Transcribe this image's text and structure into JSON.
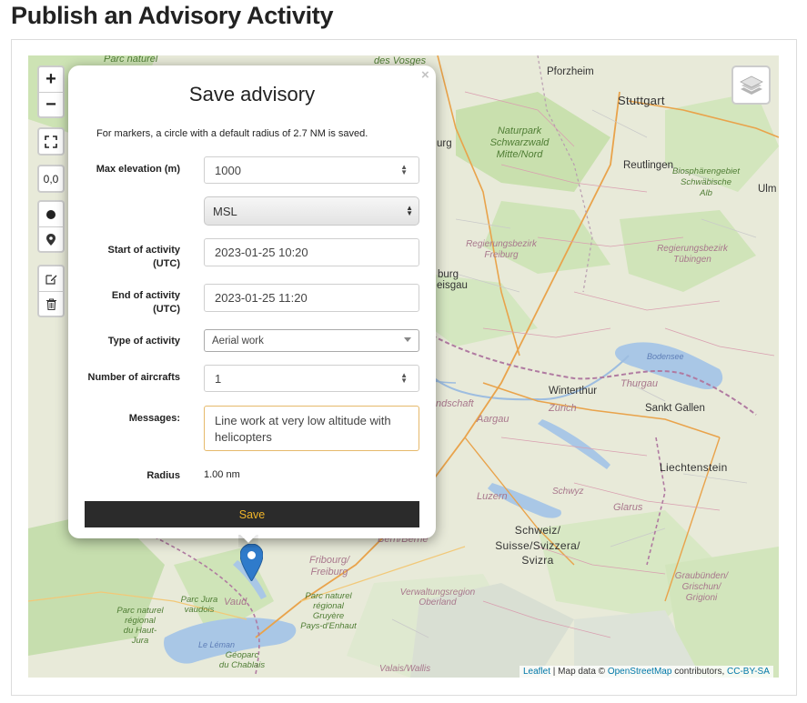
{
  "page": {
    "title": "Publish an Advisory Activity"
  },
  "map": {
    "zoom_in": "+",
    "zoom_out": "−",
    "coord_button": "0,0",
    "attribution": {
      "leaflet": "Leaflet",
      "sep": " | Map data © ",
      "osm": "OpenStreetMap",
      "contrib": " contributors, ",
      "license": "CC-BY-SA"
    },
    "labels": {
      "parc_naturel_top": "Parc naturel",
      "vosges": "des Vosges",
      "pforzheim": "Pforzheim",
      "stuttgart": "Stuttgart",
      "naturpark": "Naturpark",
      "schwarzwald": "Schwarzwald",
      "mitte_nord": "Mitte/Nord",
      "urg": "urg",
      "reutlingen": "Reutlingen",
      "biosphaeren": "Biosphärengebiet",
      "schwaebische": "Schwäbische",
      "alb": "Alb",
      "ulm": "Ulm",
      "rb_freiburg_1": "Regierungsbezirk",
      "rb_freiburg_2": "Freiburg",
      "rb_tuebingen_1": "Regierungsbezirk",
      "rb_tuebingen_2": "Tübingen",
      "burg": "burg",
      "eisgau": "eisgau",
      "bodensee": "Bodensee",
      "winterthur": "Winterthur",
      "thurgau": "Thurgau",
      "zuerich": "Zürich",
      "sankt_gallen": "Sankt Gallen",
      "ndschaft": "ndschaft",
      "aargau": "Aargau",
      "liechtenstein": "Liechtenstein",
      "luzern": "Luzern",
      "schwyz": "Schwyz",
      "glarus": "Glarus",
      "schweiz": "Schweiz/",
      "suisse": "Suisse/Svizzera/",
      "svizra": "Svizra",
      "bern": "Bern/Berne",
      "fribourg_1": "Fribourg/",
      "fribourg_2": "Freiburg",
      "vaud": "Vaud",
      "parc_jura_1": "Parc Jura",
      "parc_jura_2": "vaudois",
      "parc_gruyere_1": "Parc naturel",
      "parc_gruyere_2": "régional",
      "parc_gruyere_3": "Gruyère",
      "parc_gruyere_4": "Pays-d'Enhaut",
      "parc_hautjura_1": "Parc naturel",
      "parc_hautjura_2": "régional",
      "parc_hautjura_3": "du Haut-",
      "parc_hautjura_4": "Jura",
      "verwaltung_1": "Verwaltungsregion",
      "verwaltung_2": "Oberland",
      "graubuenden_1": "Graubünden/",
      "graubuenden_2": "Grischun/",
      "graubuenden_3": "Grigioni",
      "leman": "Le Léman",
      "geoparc_1": "Géoparc",
      "geoparc_2": "du Chablais",
      "valais": "Valais/Wallis"
    }
  },
  "popup": {
    "close": "×",
    "title": "Save advisory",
    "note": "For markers, a circle with a default radius of 2.7 NM is saved.",
    "max_elevation": {
      "label": "Max elevation (m)",
      "value": "1000"
    },
    "reference": {
      "value": "MSL"
    },
    "start": {
      "label_1": "Start of activity",
      "label_2": "(UTC)",
      "value": "2023-01-25 10:20"
    },
    "end": {
      "label_1": "End of activity",
      "label_2": "(UTC)",
      "value": "2023-01-25 11:20"
    },
    "type": {
      "label": "Type of activity",
      "value": "Aerial work"
    },
    "aircrafts": {
      "label": "Number of aircrafts",
      "value": "1"
    },
    "messages": {
      "label": "Messages:",
      "value": "Line work at very low altitude with helicopters"
    },
    "radius": {
      "label": "Radius",
      "value": "1.00 nm"
    },
    "save_label": "Save"
  }
}
